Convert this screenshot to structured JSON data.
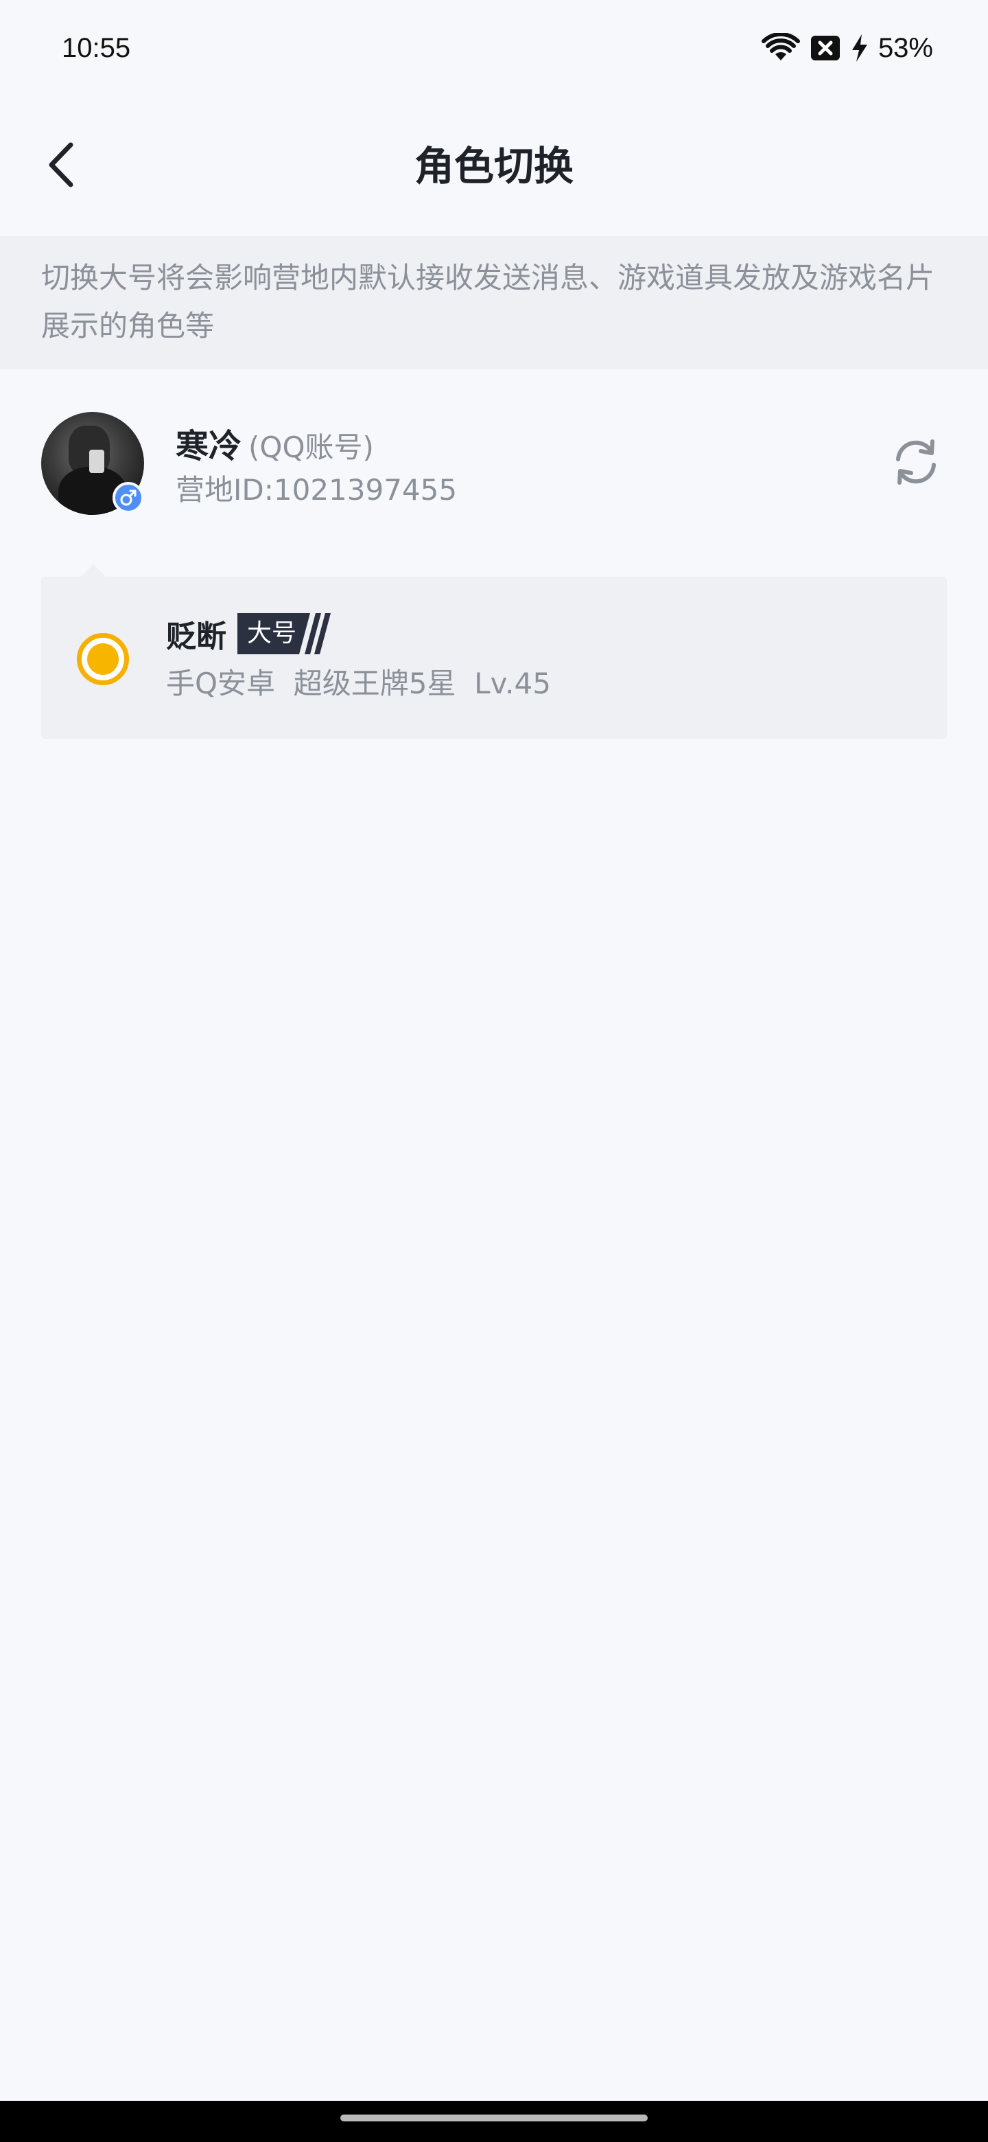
{
  "status_bar": {
    "time": "10:55",
    "battery": "53%",
    "icons": [
      "wifi-icon",
      "sim-off-icon",
      "charging-icon"
    ]
  },
  "header": {
    "title": "角色切换",
    "back_icon": "back-arrow-icon"
  },
  "notice": {
    "text": "切换大号将会影响营地内默认接收发送消息、游戏道具发放及游戏名片展示的角色等"
  },
  "account": {
    "name": "寒冷",
    "type": "(QQ账号)",
    "id": "营地ID:1021397455",
    "gender": "male",
    "switch_icon": "refresh-icon"
  },
  "roles": [
    {
      "name": "贬断",
      "tag": "大号",
      "detail": "手Q安卓  超级王牌5星  Lv.45",
      "selected": true
    }
  ],
  "colors": {
    "background": "#f6f8fc",
    "notice_bg": "#eef0f4",
    "accent_yellow": "#f7b500",
    "gender_blue": "#4f8ff3",
    "tag_dark": "#2b3140"
  }
}
